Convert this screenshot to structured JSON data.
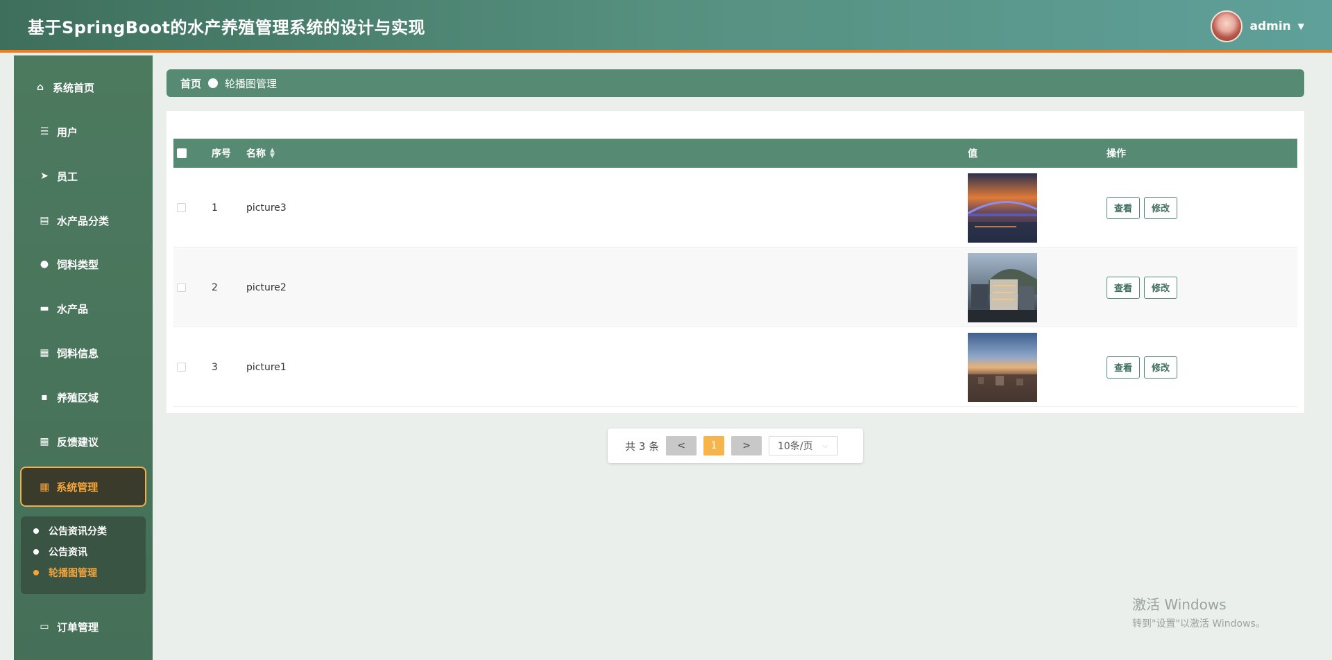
{
  "header": {
    "title": "基于SpringBoot的水产养殖管理系统的设计与实现",
    "username": "admin",
    "caret": "▼"
  },
  "sidebar": {
    "items": [
      {
        "label": "系统首页",
        "icon": "home-icon",
        "glyph": "⌂"
      },
      {
        "label": "用户",
        "icon": "list-icon",
        "glyph": "☰"
      },
      {
        "label": "员工",
        "icon": "send-icon",
        "glyph": "➤"
      },
      {
        "label": "水产品分类",
        "icon": "clipboard-icon",
        "glyph": "▤"
      },
      {
        "label": "饲料类型",
        "icon": "bulb-icon",
        "glyph": "●"
      },
      {
        "label": "水产品",
        "icon": "briefcase-icon",
        "glyph": "▬"
      },
      {
        "label": "饲料信息",
        "icon": "grid-icon",
        "glyph": "▦"
      },
      {
        "label": "养殖区域",
        "icon": "chat-icon",
        "glyph": "▪"
      },
      {
        "label": "反馈建议",
        "icon": "grid-icon",
        "glyph": "▦"
      },
      {
        "label": "订单管理",
        "icon": "monitor-icon",
        "glyph": "▭"
      }
    ],
    "active": {
      "label": "系统管理",
      "icon": "grid-icon",
      "glyph": "▦"
    },
    "submenu": [
      {
        "label": "公告资讯分类"
      },
      {
        "label": "公告资讯"
      },
      {
        "label": "轮播图管理"
      }
    ]
  },
  "breadcrumb": {
    "home": "首页",
    "current": "轮播图管理"
  },
  "table": {
    "headers": {
      "index": "序号",
      "name": "名称",
      "value": "值",
      "actions": "操作"
    },
    "rows": [
      {
        "index": "1",
        "name": "picture3",
        "image": "city-night-bridge"
      },
      {
        "index": "2",
        "name": "picture2",
        "image": "city-buildings-dusk"
      },
      {
        "index": "3",
        "name": "picture1",
        "image": "city-aerial-sunset"
      }
    ],
    "view_label": "查看",
    "edit_label": "修改"
  },
  "pagination": {
    "total": "共 3 条",
    "prev": "<",
    "page": "1",
    "next": ">",
    "page_size": "10条/页"
  },
  "watermark": {
    "line1": "激活 Windows",
    "line2": "转到\"设置\"以激活 Windows。"
  },
  "colors": {
    "primary": "#568a72",
    "accent": "#f5a53a",
    "header_border": "#f07c22"
  }
}
